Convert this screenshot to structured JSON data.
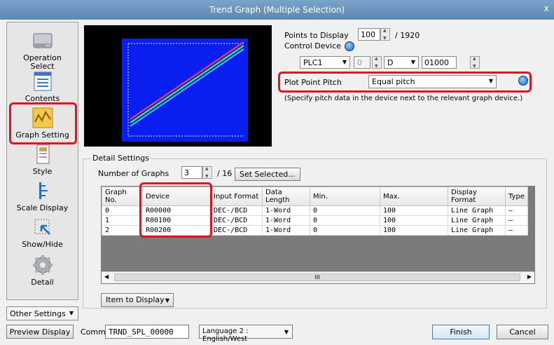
{
  "window": {
    "title": "Trend Graph (Multiple Selection)",
    "close_glyph": "x"
  },
  "sidebar": {
    "items": [
      {
        "label1": "Operation",
        "label2": "Select",
        "icon": "device-icon"
      },
      {
        "label1": "Contents",
        "icon": "contents-icon"
      },
      {
        "label1": "Graph Setting",
        "icon": "graph-icon"
      },
      {
        "label1": "Style",
        "icon": "style-icon"
      },
      {
        "label1": "Scale Display",
        "icon": "scale-icon"
      },
      {
        "label1": "Show/Hide",
        "icon": "show-hide-icon"
      },
      {
        "label1": "Detail",
        "icon": "gear-icon"
      }
    ],
    "other_settings": "Other Settings"
  },
  "settings": {
    "points_label": "Points to Display",
    "points_value": "100",
    "points_max": "/ 1920",
    "control_label": "Control Device",
    "plc": "PLC1",
    "station": "0",
    "device_type": "D",
    "address": "01000",
    "pitch_label": "Plot Point Pitch",
    "pitch_value": "Equal pitch",
    "pitch_note": "(Specify pitch data in the device next to the relevant graph device.)"
  },
  "detail": {
    "legend": "Detail Settings",
    "num_graphs_label": "Number of Graphs",
    "num_graphs_value": "3",
    "num_graphs_max": "/ 16",
    "set_selected": "Set Selected...",
    "columns": [
      "Graph No.",
      "Device",
      "Input Format",
      "Data Length",
      "Min.",
      "Max.",
      "Display Format",
      "Type"
    ],
    "rows": [
      [
        "0",
        "R00000",
        "DEC-/BCD",
        "1-Word",
        "0",
        "100",
        "Line Graph",
        "—"
      ],
      [
        "1",
        "R00100",
        "DEC-/BCD",
        "1-Word",
        "0",
        "100",
        "Line Graph",
        "—"
      ],
      [
        "2",
        "R00200",
        "DEC-/BCD",
        "1-Word",
        "0",
        "100",
        "Line Graph",
        "—"
      ]
    ],
    "scroll_mid": "III",
    "item_to_display": "Item to Display"
  },
  "footer": {
    "preview": "Preview Display",
    "comm_label": "Comm",
    "comm_value": "TRND_SPL_00000",
    "language": "Language 2 : English/West",
    "finish": "Finish",
    "cancel": "Cancel"
  },
  "colors": {
    "highlight": "#e0141e",
    "plot_background": "#0a1ef0",
    "series1": "#ff4040",
    "series2": "#40ff40",
    "series3": "#40c0ff"
  }
}
